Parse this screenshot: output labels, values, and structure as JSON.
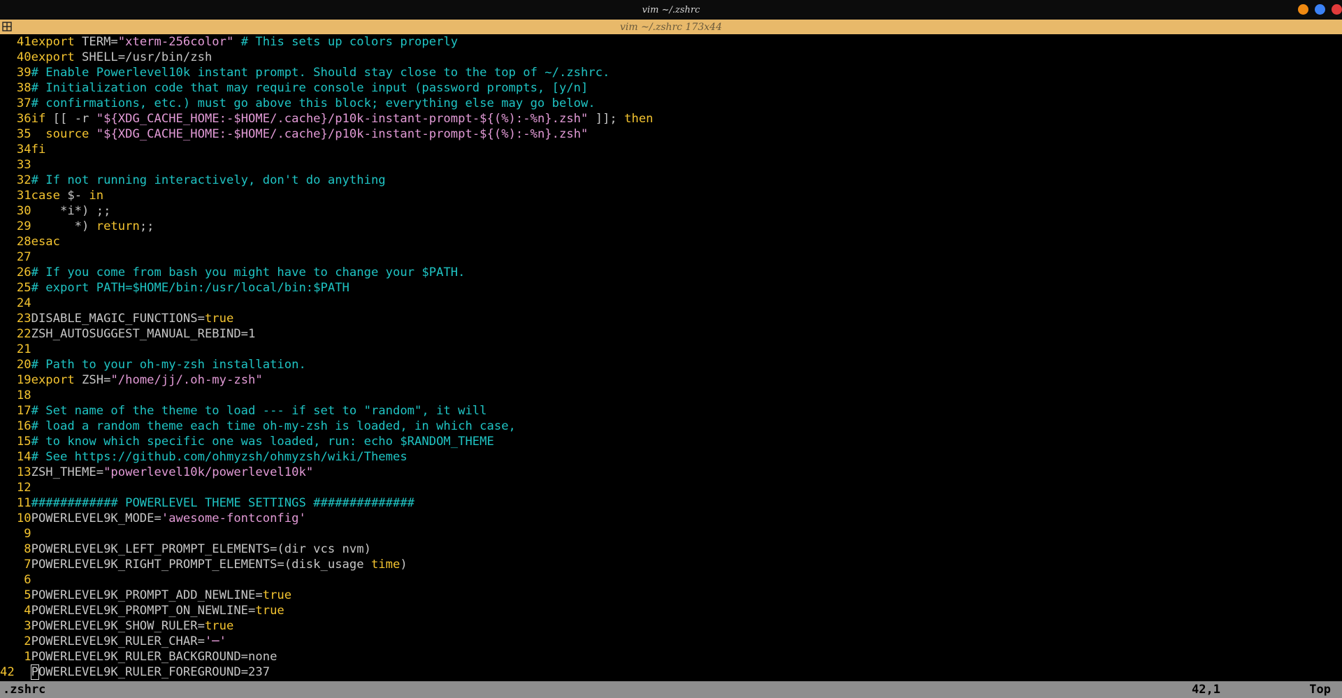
{
  "window": {
    "title": "vim ~/.zshrc",
    "buttons": [
      {
        "name": "minimize",
        "color": "#f08a12"
      },
      {
        "name": "maximize",
        "color": "#3b82f6"
      },
      {
        "name": "close",
        "color": "#e23b3b"
      }
    ]
  },
  "tab": {
    "title": "vim ~/.zshrc 173x44",
    "icon": "split-layout-icon"
  },
  "colors": {
    "keyword": "#f4c430",
    "string": "#e29ad6",
    "comment": "#1fc4c4",
    "plain": "#c6c6c6",
    "line_number": "#f4c430"
  },
  "lines": [
    {
      "num": "41",
      "segs": [
        {
          "t": "export",
          "c": "keyword"
        },
        {
          "t": " TERM=",
          "c": "plain"
        },
        {
          "t": "\"xterm-256color\"",
          "c": "string"
        },
        {
          "t": " # This sets up colors properly",
          "c": "comment"
        }
      ]
    },
    {
      "num": "40",
      "segs": [
        {
          "t": "export",
          "c": "keyword"
        },
        {
          "t": " SHELL=/usr/bin/zsh",
          "c": "plain"
        }
      ]
    },
    {
      "num": "39",
      "segs": [
        {
          "t": "# Enable Powerlevel10k instant prompt. Should stay close to the top of ~/.zshrc.",
          "c": "comment"
        }
      ]
    },
    {
      "num": "38",
      "segs": [
        {
          "t": "# Initialization code that may require console input (password prompts, [y/n]",
          "c": "comment"
        }
      ]
    },
    {
      "num": "37",
      "segs": [
        {
          "t": "# confirmations, etc.) must go above this block; everything else may go below.",
          "c": "comment"
        }
      ]
    },
    {
      "num": "36",
      "segs": [
        {
          "t": "if",
          "c": "keyword"
        },
        {
          "t": " [[ -r ",
          "c": "plain"
        },
        {
          "t": "\"${XDG_CACHE_HOME:-$HOME/.cache}/p10k-instant-prompt-${(%):-%n}.zsh\"",
          "c": "string"
        },
        {
          "t": " ]]; ",
          "c": "plain"
        },
        {
          "t": "then",
          "c": "keyword"
        }
      ]
    },
    {
      "num": "35",
      "segs": [
        {
          "t": "  ",
          "c": "plain"
        },
        {
          "t": "source",
          "c": "keyword"
        },
        {
          "t": " ",
          "c": "plain"
        },
        {
          "t": "\"${XDG_CACHE_HOME:-$HOME/.cache}/p10k-instant-prompt-${(%):-%n}.zsh\"",
          "c": "string"
        }
      ]
    },
    {
      "num": "34",
      "segs": [
        {
          "t": "fi",
          "c": "keyword"
        }
      ]
    },
    {
      "num": "33",
      "segs": []
    },
    {
      "num": "32",
      "segs": [
        {
          "t": "# If not running interactively, don't do anything",
          "c": "comment"
        }
      ]
    },
    {
      "num": "31",
      "segs": [
        {
          "t": "case",
          "c": "keyword"
        },
        {
          "t": " $- ",
          "c": "plain"
        },
        {
          "t": "in",
          "c": "keyword"
        }
      ]
    },
    {
      "num": "30",
      "segs": [
        {
          "t": "    *i*) ;;",
          "c": "plain"
        }
      ]
    },
    {
      "num": "29",
      "segs": [
        {
          "t": "      *) ",
          "c": "plain"
        },
        {
          "t": "return",
          "c": "keyword"
        },
        {
          "t": ";;",
          "c": "plain"
        }
      ]
    },
    {
      "num": "28",
      "segs": [
        {
          "t": "esac",
          "c": "keyword"
        }
      ]
    },
    {
      "num": "27",
      "segs": []
    },
    {
      "num": "26",
      "segs": [
        {
          "t": "# If you come from bash you might have to change your $PATH.",
          "c": "comment"
        }
      ]
    },
    {
      "num": "25",
      "segs": [
        {
          "t": "# export PATH=$HOME/bin:/usr/local/bin:$PATH",
          "c": "comment"
        }
      ]
    },
    {
      "num": "24",
      "segs": []
    },
    {
      "num": "23",
      "segs": [
        {
          "t": "DISABLE_MAGIC_FUNCTIONS=",
          "c": "plain"
        },
        {
          "t": "true",
          "c": "keyword"
        }
      ]
    },
    {
      "num": "22",
      "segs": [
        {
          "t": "ZSH_AUTOSUGGEST_MANUAL_REBIND=1",
          "c": "plain"
        }
      ]
    },
    {
      "num": "21",
      "segs": []
    },
    {
      "num": "20",
      "segs": [
        {
          "t": "# Path to your oh-my-zsh installation.",
          "c": "comment"
        }
      ]
    },
    {
      "num": "19",
      "segs": [
        {
          "t": "export",
          "c": "keyword"
        },
        {
          "t": " ZSH=",
          "c": "plain"
        },
        {
          "t": "\"/home/jj/.oh-my-zsh\"",
          "c": "string"
        }
      ]
    },
    {
      "num": "18",
      "segs": []
    },
    {
      "num": "17",
      "segs": [
        {
          "t": "# Set name of the theme to load --- if set to \"random\", it will",
          "c": "comment"
        }
      ]
    },
    {
      "num": "16",
      "segs": [
        {
          "t": "# load a random theme each time oh-my-zsh is loaded, in which case,",
          "c": "comment"
        }
      ]
    },
    {
      "num": "15",
      "segs": [
        {
          "t": "# to know which specific one was loaded, run: echo $RANDOM_THEME",
          "c": "comment"
        }
      ]
    },
    {
      "num": "14",
      "segs": [
        {
          "t": "# See https://github.com/ohmyzsh/ohmyzsh/wiki/Themes",
          "c": "comment"
        }
      ]
    },
    {
      "num": "13",
      "segs": [
        {
          "t": "ZSH_THEME=",
          "c": "plain"
        },
        {
          "t": "\"powerlevel10k/powerlevel10k\"",
          "c": "string"
        }
      ]
    },
    {
      "num": "12",
      "segs": []
    },
    {
      "num": "11",
      "segs": [
        {
          "t": "############ POWERLEVEL THEME SETTINGS ##############",
          "c": "comment"
        }
      ]
    },
    {
      "num": "10",
      "segs": [
        {
          "t": "POWERLEVEL9K_MODE=",
          "c": "plain"
        },
        {
          "t": "'awesome-fontconfig'",
          "c": "string"
        }
      ]
    },
    {
      "num": "9",
      "segs": []
    },
    {
      "num": "8",
      "segs": [
        {
          "t": "POWERLEVEL9K_LEFT_PROMPT_ELEMENTS=(dir vcs nvm)",
          "c": "plain"
        }
      ]
    },
    {
      "num": "7",
      "segs": [
        {
          "t": "POWERLEVEL9K_RIGHT_PROMPT_ELEMENTS=(disk_usage ",
          "c": "plain"
        },
        {
          "t": "time",
          "c": "keyword"
        },
        {
          "t": ")",
          "c": "plain"
        }
      ]
    },
    {
      "num": "6",
      "segs": []
    },
    {
      "num": "5",
      "segs": [
        {
          "t": "POWERLEVEL9K_PROMPT_ADD_NEWLINE=",
          "c": "plain"
        },
        {
          "t": "true",
          "c": "keyword"
        }
      ]
    },
    {
      "num": "4",
      "segs": [
        {
          "t": "POWERLEVEL9K_PROMPT_ON_NEWLINE=",
          "c": "plain"
        },
        {
          "t": "true",
          "c": "keyword"
        }
      ]
    },
    {
      "num": "3",
      "segs": [
        {
          "t": "POWERLEVEL9K_SHOW_RULER=",
          "c": "plain"
        },
        {
          "t": "true",
          "c": "keyword"
        }
      ]
    },
    {
      "num": "2",
      "segs": [
        {
          "t": "POWERLEVEL9K_RULER_CHAR=",
          "c": "plain"
        },
        {
          "t": "'─'",
          "c": "string"
        }
      ]
    },
    {
      "num": "1",
      "segs": [
        {
          "t": "POWERLEVEL9K_RULER_BACKGROUND=none",
          "c": "plain"
        }
      ]
    },
    {
      "num": "42",
      "current": true,
      "segs": [
        {
          "t": "P",
          "c": "plain",
          "cursor": true
        },
        {
          "t": "OWERLEVEL9K_RULER_FOREGROUND=237",
          "c": "plain"
        }
      ]
    }
  ],
  "status": {
    "filename": ".zshrc",
    "position": "42,1",
    "scroll": "Top"
  }
}
